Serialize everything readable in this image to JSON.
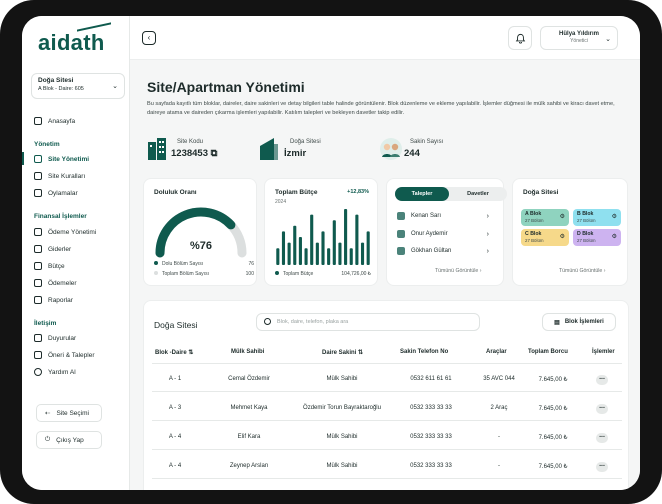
{
  "brand": {
    "name": "aidath"
  },
  "site_selector": {
    "name": "Doğa Sitesi",
    "unit": "A Blok - Daire: 605"
  },
  "nav": {
    "home": "Anasayfa",
    "sec_management": "Yönetim",
    "site_management": "Site Yönetimi",
    "site_rules": "Site Kuralları",
    "votes": "Oylamalar",
    "sec_finance": "Finansal İşlemler",
    "payment_management": "Ödeme Yönetimi",
    "expenses": "Giderler",
    "budget": "Bütçe",
    "payments": "Ödemeler",
    "reports": "Raporlar",
    "sec_comm": "İletişim",
    "announcements": "Duyurular",
    "suggestions": "Öneri & Talepler",
    "help": "Yardım Al",
    "site_choose": "Site Seçimi",
    "logout": "Çıkış Yap"
  },
  "user": {
    "name": "Hülya Yıldırım",
    "role": "Yönetici"
  },
  "page": {
    "title": "Site/Apartman Yönetimi",
    "description": "Bu sayfada kayıtlı tüm bloklar, daireler, daire sakinleri ve detay bilgileri table halinde görüntülenir. Blok düzenleme ve ekleme yapılabilir. İşlemler düğmesi ile mülk sahibi ve kiracı davet etme, daireye atama ve daireden çıkarma işlemleri yapılabilir. Katılım talepleri ve bekleyen davetler takip edilir."
  },
  "stats": {
    "site_code_label": "Site Kodu",
    "site_code": "1238453",
    "site_label": "Doğa Sitesi",
    "site_city": "İzmir",
    "residents_label": "Sakin Sayısı",
    "residents": "244"
  },
  "occupancy": {
    "title": "Doluluk Oranı",
    "percent_label": "%76",
    "filled_label": "Dolu Bölüm Sayısı",
    "filled": "76",
    "total_label": "Toplam Bölüm Sayısı",
    "total": "100",
    "ratio": 0.76
  },
  "budget": {
    "title": "Toplam Bütçe",
    "year": "2024",
    "change": "+12,83%",
    "legend": "Toplam Bütçe",
    "amount": "104,726,00 ₺"
  },
  "chart_data": {
    "type": "bar",
    "title": "Toplam Bütçe",
    "values": [
      3,
      6,
      4,
      7,
      5,
      3,
      9,
      4,
      6,
      3,
      8,
      4,
      10,
      3,
      9,
      4,
      6
    ],
    "ylim": [
      0,
      10
    ]
  },
  "requests": {
    "tab_requests": "Talepler",
    "tab_invites": "Davetler",
    "items": [
      {
        "name": "Kenan Sarı"
      },
      {
        "name": "Onur Aydemir"
      },
      {
        "name": "Gökhan Gültan"
      }
    ],
    "see_all": "Tümünü Görüntüle"
  },
  "blocks": {
    "title": "Doğa Sitesi",
    "items": [
      {
        "name": "A Blok",
        "sub": "27 Bölüm",
        "color": "#8fd3bf"
      },
      {
        "name": "B Blok",
        "sub": "27 Bölüm",
        "color": "#8fe0ef"
      },
      {
        "name": "C Blok",
        "sub": "27 Bölüm",
        "color": "#f6d98a"
      },
      {
        "name": "D Blok",
        "sub": "27 Bölüm",
        "color": "#cdb3f0"
      }
    ],
    "see_all": "Tümünü Görüntüle"
  },
  "table": {
    "title": "Doğa Sitesi",
    "search_placeholder": "Blok, daire, telefon, plaka ara",
    "block_ops": "Blok İşlemleri",
    "headers": [
      "Blok -Daire",
      "Mülk Sahibi",
      "Daire Sakini",
      "Sakin Telefon No",
      "Araçlar",
      "Toplam Borcu",
      "İşlemler"
    ],
    "rows": [
      [
        "A - 1",
        "Cemal Özdemir",
        "Mülk Sahibi",
        "0532 611 61 61",
        "35 AVC 044",
        "7.645,00 ₺",
        "..."
      ],
      [
        "A - 3",
        "Mehmet Kaya",
        "Özdemir Torun Bayraktaroğlu",
        "0532 333 33 33",
        "2 Araç",
        "7.645,00 ₺",
        "..."
      ],
      [
        "A - 4",
        "Elif Kara",
        "Mülk Sahibi",
        "0532 333 33 33",
        "-",
        "7.645,00 ₺",
        "..."
      ],
      [
        "A - 4",
        "Zeynep Arslan",
        "Mülk Sahibi",
        "0532 333 33 33",
        "-",
        "7.645,00 ₺",
        "..."
      ]
    ]
  }
}
